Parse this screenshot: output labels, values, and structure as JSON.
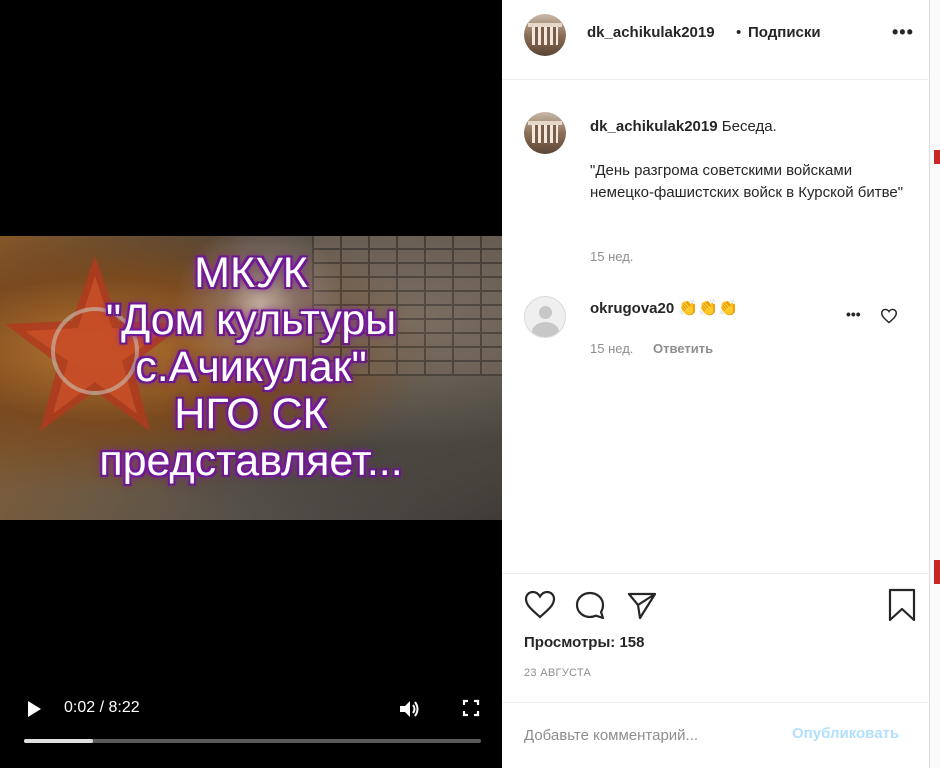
{
  "video": {
    "overlay_lines": [
      "МКУК",
      "\"Дом культуры",
      "с.Ачикулак\"",
      "НГО СК",
      "представляет..."
    ],
    "time_display": "0:02 / 8:22",
    "progress_fraction": 0.15,
    "icons": {
      "play": "play-icon",
      "volume": "volume-icon",
      "fullscreen": "fullscreen-icon"
    }
  },
  "header": {
    "username": "dk_achikulak2019",
    "separator": "•",
    "follow_label": "Подписки",
    "more_icon": "•••"
  },
  "caption": {
    "username": "dk_achikulak2019",
    "text": "Беседа.",
    "quote": "\"День разгрома советскими войсками немецко-фашистских войск в Курской битве\"",
    "time": "15 нед."
  },
  "comment": {
    "username": "okrugova20",
    "emoji": "👏👏👏",
    "time": "15 нед.",
    "reply_label": "Ответить",
    "more_icon": "•••"
  },
  "stats": {
    "views_label": "Просмотры:",
    "views_count": "158",
    "date": "23 АВГУСТА"
  },
  "comment_form": {
    "placeholder": "Добавьте комментарий...",
    "publish_label": "Опубликовать"
  },
  "colors": {
    "link_disabled": "#b2dffc",
    "secondary_text": "#8e8e8e",
    "title_glow": "#7b1fa2"
  }
}
